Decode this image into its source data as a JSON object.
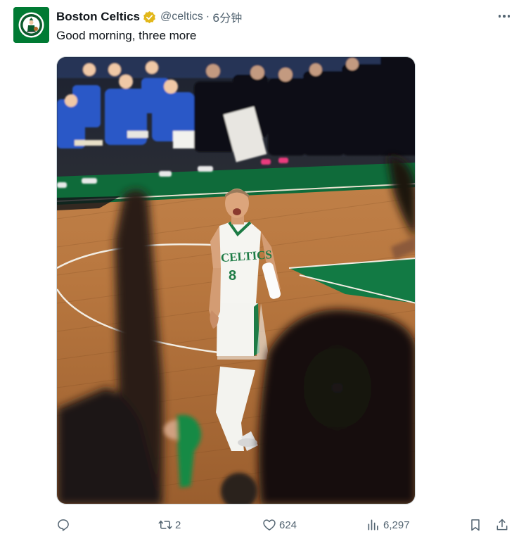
{
  "account": {
    "name": "Boston Celtics",
    "handle": "@celtics",
    "separator": "·",
    "time": "6分钟",
    "verified_icon": "verified-badge-icon",
    "avatar_icon": "celtics-logo-icon"
  },
  "tweet": {
    "text": "Good morning, three more"
  },
  "photo": {
    "jersey_wordmark": "CELTICS",
    "jersey_number": "8"
  },
  "actions": {
    "reply": {
      "icon": "reply-icon",
      "count": ""
    },
    "retweet": {
      "icon": "retweet-icon",
      "count": "2"
    },
    "like": {
      "icon": "heart-icon",
      "count": "624"
    },
    "views": {
      "icon": "views-bar-chart-icon",
      "count": "6,297"
    },
    "bookmark": {
      "icon": "bookmark-icon"
    },
    "share": {
      "icon": "share-icon"
    }
  },
  "colors": {
    "celtics_green": "#007a33",
    "verified_gold": "#e2b719",
    "secondary_text": "#536471"
  }
}
